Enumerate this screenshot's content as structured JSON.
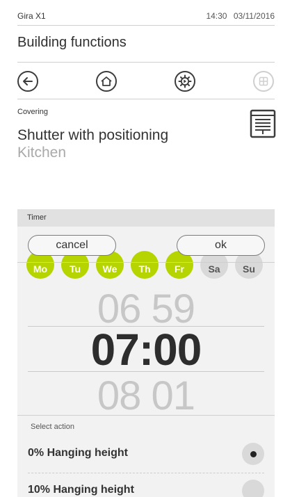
{
  "status_bar": {
    "device": "Gira X1",
    "time": "14:30",
    "date": "03/11/2016"
  },
  "page": {
    "title": "Building functions"
  },
  "nav": {
    "back_icon": "arrow-left-icon",
    "home_icon": "home-icon",
    "settings_icon": "gear-icon",
    "grid_icon": "grid-icon"
  },
  "function": {
    "category": "Covering",
    "name": "Shutter with positioning",
    "room": "Kitchen",
    "icon": "shutter-icon"
  },
  "timer": {
    "header": "Timer",
    "cancel_label": "cancel",
    "ok_label": "ok",
    "days": [
      {
        "label": "Mo",
        "active": true
      },
      {
        "label": "Tu",
        "active": true
      },
      {
        "label": "We",
        "active": true
      },
      {
        "label": "Th",
        "active": true
      },
      {
        "label": "Fr",
        "active": true
      },
      {
        "label": "Sa",
        "active": false
      },
      {
        "label": "Su",
        "active": false
      }
    ],
    "time_prev": "06 59",
    "time_current": "07:00",
    "time_next": "08 01",
    "select_action_label": "Select action",
    "options": [
      {
        "label": "0% Hanging height",
        "selected": true
      },
      {
        "label": "10% Hanging height",
        "selected": false
      }
    ]
  },
  "colors": {
    "accent": "#b6d400",
    "panel_bg": "#f2f2f2",
    "header_bg": "#e1e1e1"
  }
}
